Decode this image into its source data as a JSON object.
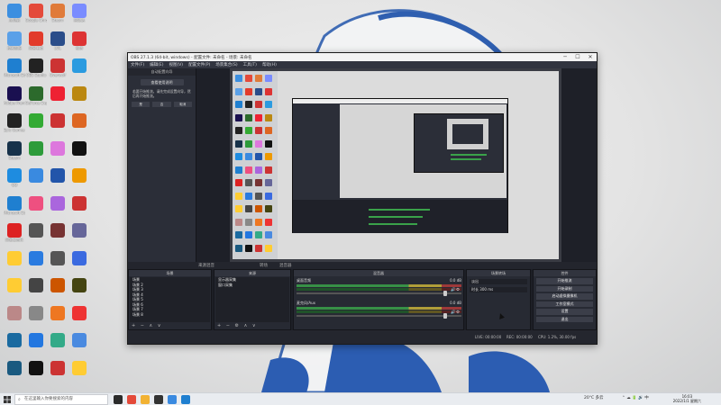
{
  "desktop": {
    "icons": [
      {
        "label": "此电脑",
        "color": "#3c8fe0"
      },
      {
        "label": "Google Chrome",
        "color": "#e44a3a"
      },
      {
        "label": "Steam",
        "color": "#e07b3a"
      },
      {
        "label": "回收站",
        "color": "#7a8cff"
      },
      {
        "label": "控制面板",
        "color": "#5aa0e8"
      },
      {
        "label": "网易有道",
        "color": "#e23b2b"
      },
      {
        "label": "LOL",
        "color": "#2a4d8a"
      },
      {
        "label": "微博",
        "color": "#d33"
      },
      {
        "label": "Microsoft Edge",
        "color": "#1f7fd0"
      },
      {
        "label": "OBS Studio",
        "color": "#222"
      },
      {
        "label": "Overwolf",
        "color": "#c33"
      },
      {
        "label": "",
        "color": "#2b9be0"
      },
      {
        "label": "Adobe Premiere",
        "color": "#1a1050"
      },
      {
        "label": "GeForce Experience",
        "color": "#2c6a2c"
      },
      {
        "label": "",
        "color": "#e23"
      },
      {
        "label": "",
        "color": "#b81"
      },
      {
        "label": "Epic Games Launcher",
        "color": "#222"
      },
      {
        "label": "",
        "color": "#3a3"
      },
      {
        "label": "",
        "color": "#c33"
      },
      {
        "label": "",
        "color": "#d62"
      },
      {
        "label": "Steam",
        "color": "#17324a"
      },
      {
        "label": "",
        "color": "#2d9b3a"
      },
      {
        "label": "",
        "color": "#d7d"
      },
      {
        "label": "",
        "color": "#111"
      },
      {
        "label": "QQ",
        "color": "#1e8ce0"
      },
      {
        "label": "",
        "color": "#3a8ae0"
      },
      {
        "label": "",
        "color": "#2255aa"
      },
      {
        "label": "",
        "color": "#e90"
      },
      {
        "label": "Microsoft Edge",
        "color": "#1f7fd0"
      },
      {
        "label": "",
        "color": "#ee5080"
      },
      {
        "label": "",
        "color": "#a6d"
      },
      {
        "label": "",
        "color": "#c33"
      },
      {
        "label": "网易云音乐",
        "color": "#d22"
      },
      {
        "label": "",
        "color": "#555"
      },
      {
        "label": "",
        "color": "#733"
      },
      {
        "label": "",
        "color": "#669"
      },
      {
        "label": "",
        "color": "#ffcc33"
      },
      {
        "label": "",
        "color": "#2a7be0"
      },
      {
        "label": "",
        "color": "#555"
      },
      {
        "label": "",
        "color": "#3a6ae0"
      },
      {
        "label": "",
        "color": "#ffcc33"
      },
      {
        "label": "",
        "color": "#444"
      },
      {
        "label": "",
        "color": "#c50"
      },
      {
        "label": "",
        "color": "#441"
      },
      {
        "label": "",
        "color": "#b88"
      },
      {
        "label": "",
        "color": "#888"
      },
      {
        "label": "",
        "color": "#e72"
      },
      {
        "label": "",
        "color": "#e33"
      },
      {
        "label": "",
        "color": "#1a6aa0"
      },
      {
        "label": "",
        "color": "#2377e0"
      },
      {
        "label": "",
        "color": "#3a8"
      },
      {
        "label": "",
        "color": "#4a8ae0"
      },
      {
        "label": "",
        "color": "#1a5a80"
      },
      {
        "label": "",
        "color": "#111"
      },
      {
        "label": "",
        "color": "#c33"
      },
      {
        "label": "",
        "color": "#ffcc33"
      }
    ]
  },
  "obs": {
    "title": "OBS 27.1.3 (64-bit, windows) - 配置文件: 未命名 - 场景: 未命名",
    "window_buttons": {
      "minimize": "─",
      "maximize": "☐",
      "close": "✕"
    },
    "menu": [
      "文件(F)",
      "编辑(E)",
      "视图(V)",
      "配置文件(P)",
      "场景集合(S)",
      "工具(T)",
      "帮助(H)"
    ],
    "notice": {
      "header": "自动配置向导",
      "button": "查看使用说明",
      "text": "若要开始推流，请先完成设置向导，然后再开始推流。",
      "buttons": [
        "是",
        "否",
        "取消"
      ]
    },
    "dock_header_tabs": [
      "来源混音",
      "转场",
      "混音器"
    ],
    "scenes": {
      "title": "场景",
      "items": [
        "场景",
        "场景 2",
        "场景 3",
        "场景 4",
        "场景 5",
        "场景 6",
        "场景 7",
        "场景 8",
        "场景 9"
      ],
      "controls": "+ − ∧ ∨"
    },
    "sources": {
      "title": "来源",
      "items": [
        "显示器采集",
        "窗口采集"
      ],
      "controls": "+ − ⚙ ∧ ∨"
    },
    "mixer": {
      "title": "混音器",
      "channels": [
        {
          "name": "桌面音频",
          "value": "0.0 dB"
        },
        {
          "name": "麦克风/Aux",
          "value": "0.0 dB"
        }
      ]
    },
    "transitions": {
      "title": "场景转场",
      "type": "淡出",
      "duration_label": "时长",
      "duration": "300 ms"
    },
    "controls": {
      "title": "控件",
      "buttons": [
        "开始推流",
        "开始录制",
        "启动虚拟摄像机",
        "工作室模式",
        "设置",
        "退出"
      ]
    },
    "status": {
      "live": "LIVE: 00:00:00",
      "rec": "REC: 00:00:00",
      "cpu": "CPU: 1.2%, 30.00 fps"
    }
  },
  "taskbar": {
    "search_placeholder": "在这里输入你要搜索的内容",
    "weather": "20°C 多云",
    "time": "16:03",
    "date": "2022/1/1 星期六",
    "apps": [
      {
        "name": "task-view",
        "color": "#2b2b2b"
      },
      {
        "name": "chrome",
        "color": "#e44a3a"
      },
      {
        "name": "explorer",
        "color": "#f2b233"
      },
      {
        "name": "obs",
        "color": "#333"
      },
      {
        "name": "app5",
        "color": "#3a8ae0"
      },
      {
        "name": "app6",
        "color": "#1f7fd0"
      }
    ]
  }
}
